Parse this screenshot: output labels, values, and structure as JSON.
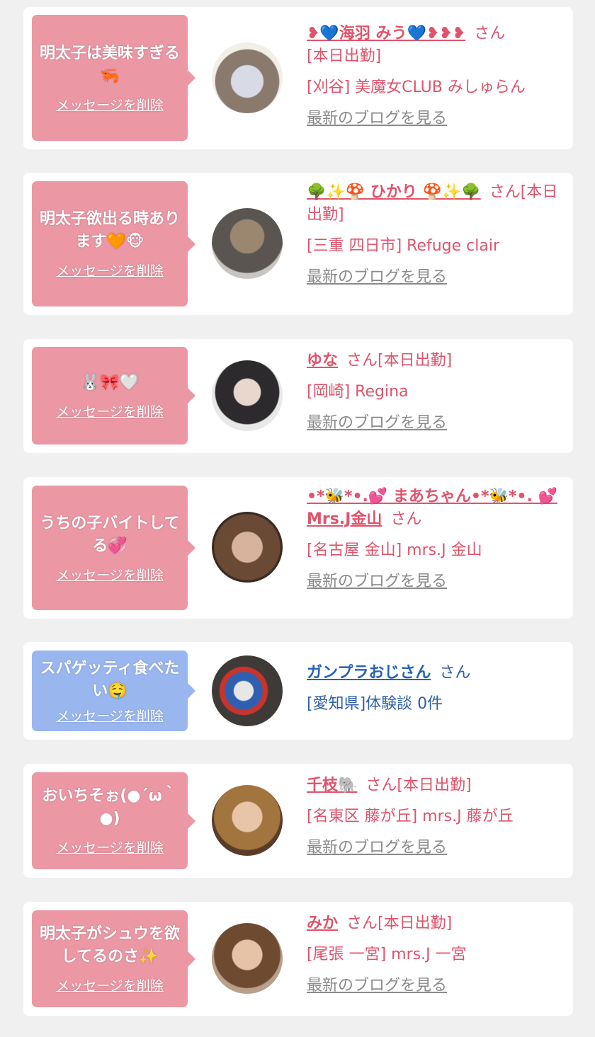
{
  "delete_label": "メッセージを削除",
  "blog_label": "最新のブログを見る",
  "san": "さん",
  "cards": [
    {
      "message": "明太子は美味すぎる🦐",
      "name": "❥💙海羽 みう💙❥❥❥",
      "status": "[本日出勤]",
      "shop": "[刈谷] 美魔女CLUB みしゅらん"
    },
    {
      "message": "明太子欲出る時あります🧡🐵",
      "name": "🌳✨🍄 ひかり 🍄✨🌳",
      "status": "[本日出勤]",
      "shop": "[三重 四日市] Refuge clair"
    },
    {
      "message": "🐰🎀🤍",
      "name": "ゆな",
      "status": "[本日出勤]",
      "shop": "[岡崎] Regina"
    },
    {
      "message": "うちの子バイトしてる💞",
      "name": "•*🐝*•.💕 まあちゃん•*🐝*•. 💕Mrs.J金山",
      "status": "",
      "shop": "[名古屋 金山] mrs.J 金山"
    },
    {
      "message": "スパゲッティ食べたい🤤",
      "name": "ガンプラおじさん",
      "status": "",
      "shop": "[愛知県]体験談 0件"
    },
    {
      "message": "おいちそぉ(●´ω｀●)",
      "name": "千枝🐘",
      "status": "[本日出勤]",
      "shop": "[名東区 藤が丘] mrs.J 藤が丘"
    },
    {
      "message": "明太子がシュウを欲してるのさ✨",
      "name": "みか",
      "status": "[本日出勤]",
      "shop": "[尾張 一宮] mrs.J 一宮"
    }
  ],
  "colors": {
    "pink_bubble": "#eb97a4",
    "blue_bubble": "#99b6ef",
    "name_pink": "#e0536b",
    "name_blue": "#2563b8"
  }
}
